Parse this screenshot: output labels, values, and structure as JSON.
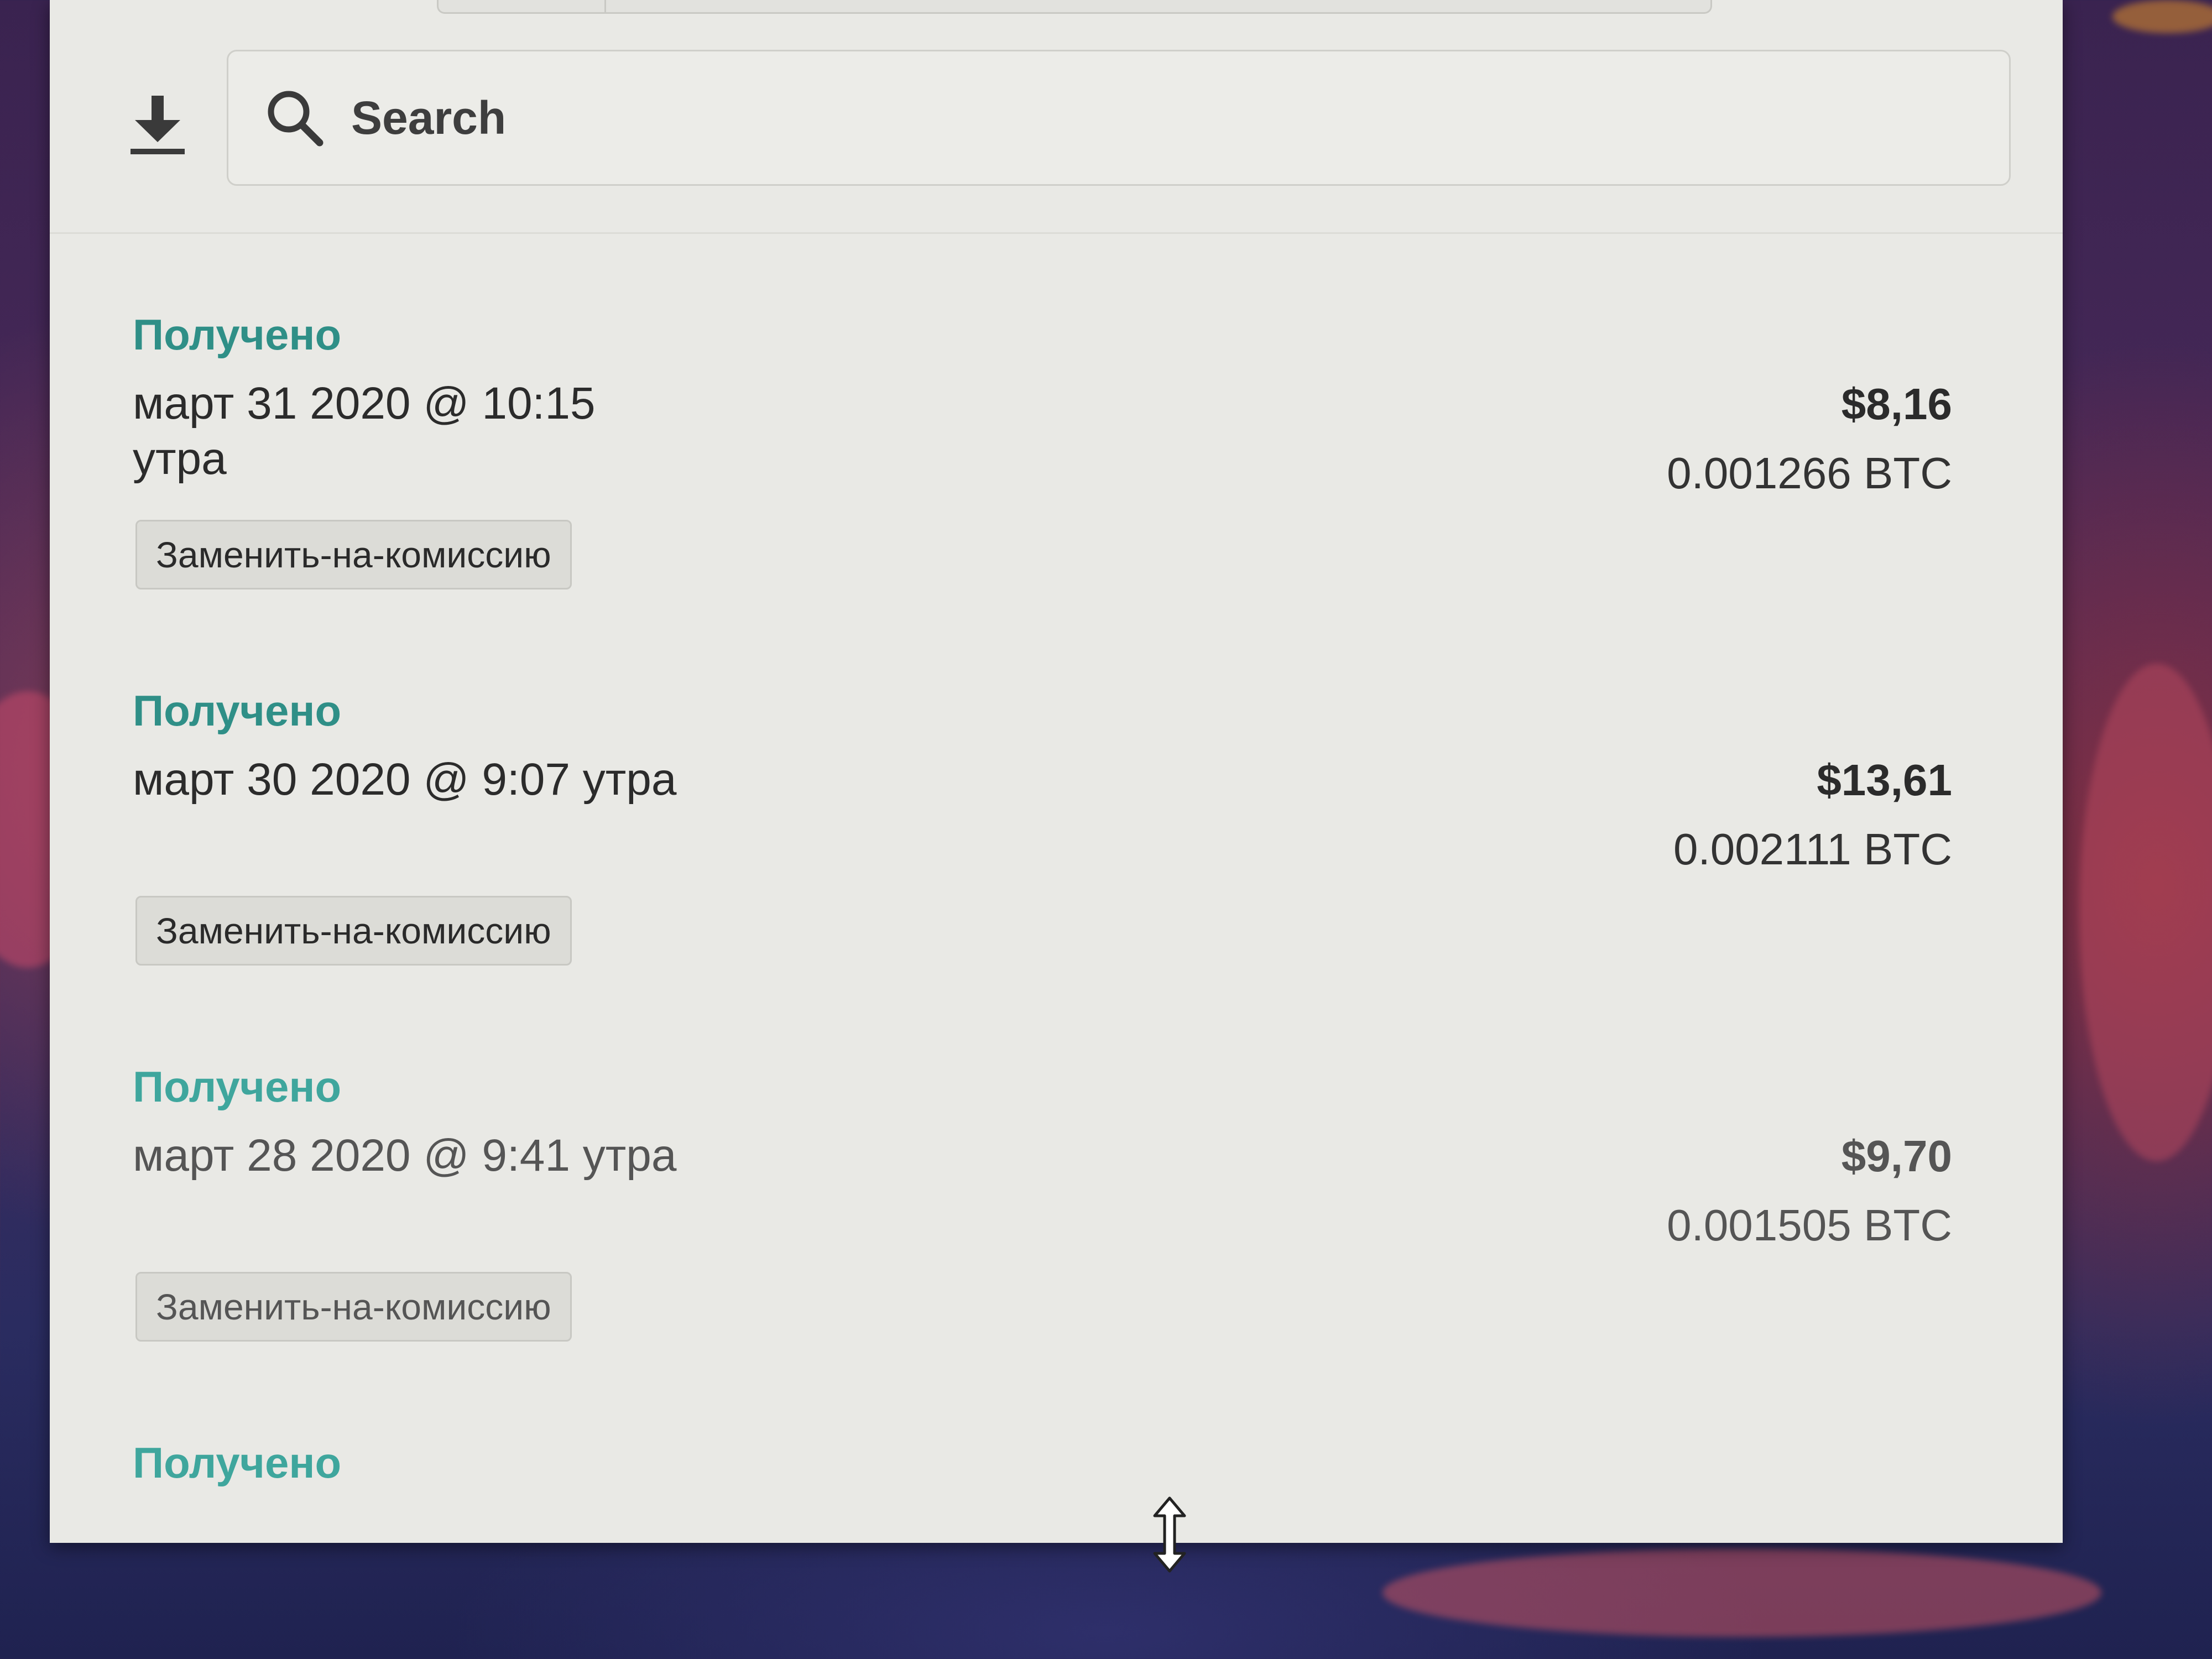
{
  "search": {
    "placeholder": "Search"
  },
  "transactions": [
    {
      "status": "Получено",
      "date": "март 31 2020 @ 10:15 утра",
      "tag": "Заменить-на-комиссию",
      "fiat": "$8,16",
      "btc": "0.001266 BTC"
    },
    {
      "status": "Получено",
      "date": "март 30 2020 @ 9:07 утра",
      "tag": "Заменить-на-комиссию",
      "fiat": "$13,61",
      "btc": "0.002111 BTC"
    },
    {
      "status": "Получено",
      "date": "март 28 2020 @ 9:41 утра",
      "tag": "Заменить-на-комиссию",
      "fiat": "$9,70",
      "btc": "0.001505 BTC"
    },
    {
      "status": "Получено"
    }
  ],
  "colors": {
    "status_accent": "#2f8f87",
    "panel_background": "#e9e9e5"
  },
  "icons": {
    "download": "download-icon",
    "search": "search-icon",
    "resize_cursor": "resize-vertical-cursor-icon"
  }
}
